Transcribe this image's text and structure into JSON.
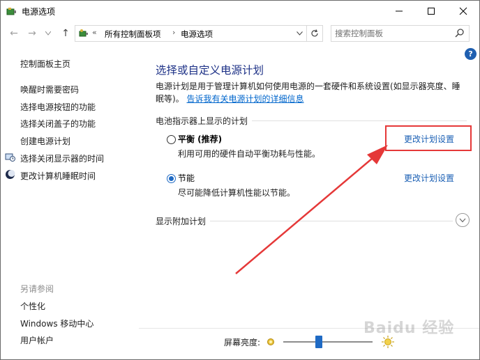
{
  "window": {
    "title": "电源选项"
  },
  "nav": {
    "back": "←",
    "forward": "→",
    "up": "↑",
    "crumb_prefix": "«",
    "crumbs": [
      "所有控制面板项",
      "电源选项"
    ],
    "crumb_sep": "›",
    "search_placeholder": "搜索控制面板"
  },
  "help": {
    "label": "?"
  },
  "sidebar": {
    "home": "控制面板主页",
    "links": [
      "唤醒时需要密码",
      "选择电源按钮的功能",
      "选择关闭盖子的功能",
      "创建电源计划",
      "选择关闭显示器的时间",
      "更改计算机睡眠时间"
    ],
    "see_also_title": "另请参阅",
    "see_also": [
      "个性化",
      "Windows 移动中心",
      "用户帐户"
    ]
  },
  "main": {
    "heading": "选择或自定义电源计划",
    "description": "电源计划是用于管理计算机如何使用电源的一套硬件和系统设置(如显示器亮度、睡眠等)。",
    "learn_more": "告诉我有关电源计划的详细信息",
    "plans_section": "电池指示器上显示的计划",
    "plans": [
      {
        "name": "平衡 (推荐)",
        "desc": "利用可用的硬件自动平衡功耗与性能。",
        "selected": false,
        "link": "更改计划设置"
      },
      {
        "name": "节能",
        "desc": "尽可能降低计算机性能以节能。",
        "selected": true,
        "link": "更改计划设置"
      }
    ],
    "additional_section": "显示附加计划"
  },
  "bottom": {
    "brightness_label": "屏幕亮度:",
    "brightness_value": 0.4
  },
  "watermark": "Baidu 经验",
  "colors": {
    "heading": "#1e3287",
    "link": "#1a5fb4",
    "accent": "#1f6ac4",
    "annotation": "#e53838"
  }
}
